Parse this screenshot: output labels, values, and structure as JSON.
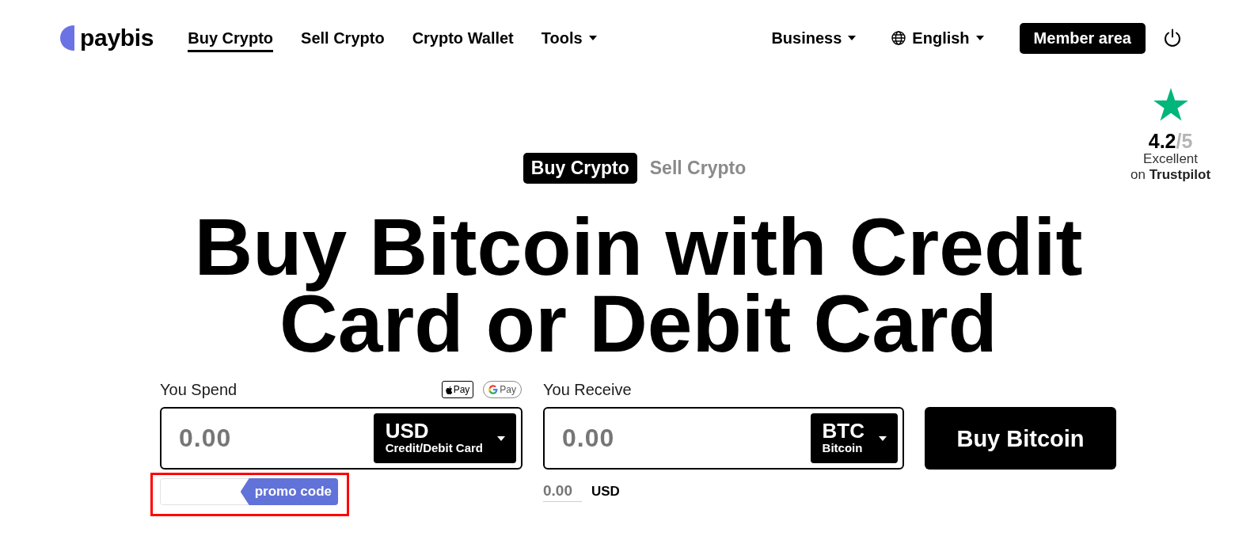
{
  "logo": {
    "name": "paybis"
  },
  "nav": [
    {
      "label": "Buy Crypto",
      "selected": true,
      "dropdown": false
    },
    {
      "label": "Sell Crypto",
      "selected": false,
      "dropdown": false
    },
    {
      "label": "Crypto Wallet",
      "selected": false,
      "dropdown": false
    },
    {
      "label": "Tools",
      "selected": false,
      "dropdown": true
    }
  ],
  "header_actions": [
    {
      "kind": "menu",
      "label": "Business"
    },
    {
      "kind": "language",
      "label": "English"
    },
    {
      "kind": "button",
      "label": "Member area"
    },
    {
      "kind": "power"
    }
  ],
  "rating": {
    "score": "4.2",
    "scale": "/5",
    "verdict": "Excellent",
    "source": "on **Trustpilot**"
  },
  "mode_tabs": [
    {
      "label": "Buy Crypto",
      "selected": true
    },
    {
      "label": "Sell Crypto",
      "selected": false
    }
  ],
  "heading": "Buy Bitcoin with Credit Card or Debit Card",
  "spend": {
    "label": "You Spend",
    "wallets": [
      {
        "kind": "apple",
        "label": "Pay"
      },
      {
        "kind": "google",
        "label": "Pay"
      }
    ],
    "amount": {
      "placeholder": "0.00"
    },
    "currency": {
      "code": "USD",
      "detail": "Credit/Debit Card"
    }
  },
  "promo": {
    "label": "promo code",
    "highlighted": true
  },
  "receive": {
    "label": "You Receive",
    "amount": {
      "placeholder": "0.00"
    },
    "currency": {
      "code": "BTC",
      "detail": "Bitcoin"
    }
  },
  "converted": {
    "amount": {
      "placeholder": "0.00"
    },
    "currency": "USD"
  },
  "buy_button": "Buy Bitcoin"
}
